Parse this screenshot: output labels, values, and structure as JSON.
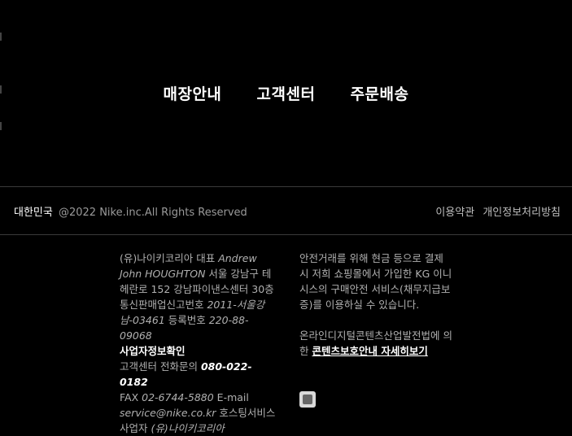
{
  "nav": {
    "items": [
      "매장안내",
      "고객센터",
      "주문배송"
    ]
  },
  "legal": {
    "country": "대한민국",
    "copyright": "@2022 Nike.inc.All Rights Reserved",
    "links": [
      "이용약관",
      "개인정보처리방침"
    ]
  },
  "company": {
    "line1_a": "(유)나이키코리아 대표 ",
    "line1_b": "Andrew John HOUGHTON",
    "line1_c": " 서울 강남구 테헤란로 152 강남파이낸스센터 30층",
    "line2_a": "통신판매업신고번호 ",
    "line2_b": "2011-서울강남-03461",
    "line2_c": " 등록번호 ",
    "line2_d": "220-88-09068",
    "biz_check": "사업자정보확인",
    "line3_a": "고객센터 전화문의 ",
    "line3_phone": "080-022-0182",
    "line4_a": "FAX ",
    "line4_fax": "02-6744-5880",
    "line4_c": " E-mail",
    "email": "service@nike.co.kr",
    "line5_a": " 호스팅서비스사업자 ",
    "host": "(유)나이키코리아"
  },
  "notice": {
    "para1": "안전거래를 위해 현금 등으로 결제 시 저희 쇼핑몰에서 가입한 KG 이니시스의 구매안전 서비스(채무지급보증)를 이용하실 수 있습니다.",
    "para2": "온라인디지털콘텐츠산업발전법에 의한 ",
    "link": "콘텐츠보호안내 자세히보기"
  }
}
